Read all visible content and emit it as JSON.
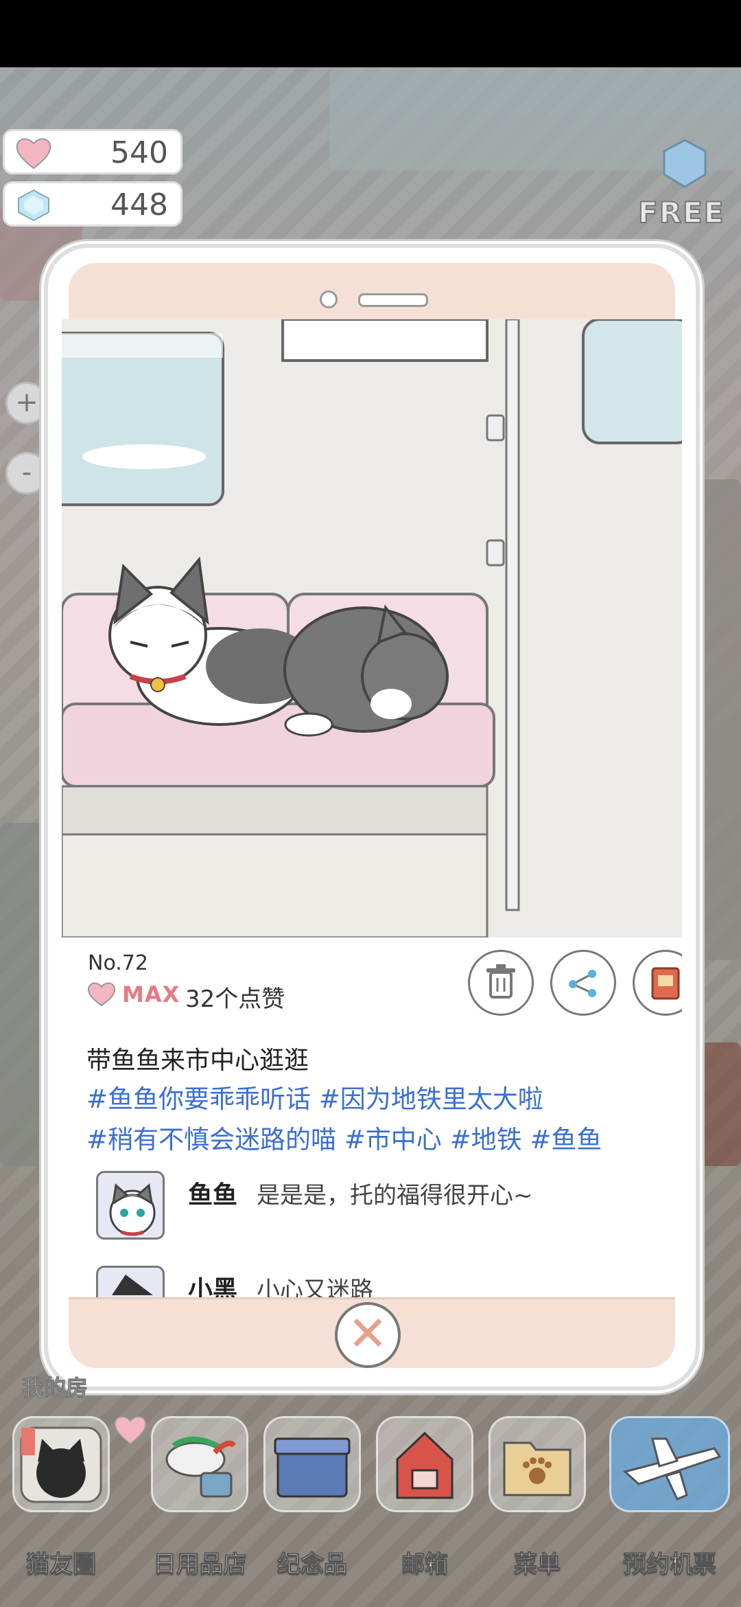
{
  "hud": {
    "hearts": "540",
    "gems": "448",
    "free_label": "FREE"
  },
  "side": {
    "zoom_in": "+",
    "zoom_out": "-"
  },
  "post": {
    "number": "No.72",
    "max_label": "MAX",
    "likes": "32个点赞",
    "caption": "带鱼鱼来市中心逛逛",
    "tags": [
      "#鱼鱼你要乖乖听话",
      "#因为地铁里太大啦",
      "#稍有不慎会迷路的喵",
      "#市中心",
      "#地铁",
      "#鱼鱼"
    ],
    "comments": [
      {
        "name": "鱼鱼",
        "text": "是是是，托的福得很开心~"
      },
      {
        "name": "小黑",
        "text": "小心又迷路"
      }
    ]
  },
  "room_label": "我的房",
  "dock": [
    {
      "label": "猫友圈",
      "icon": "black-cat-camera-icon"
    },
    {
      "label": "日用品店",
      "icon": "fish-shop-icon"
    },
    {
      "label": "纪念品",
      "icon": "souvenir-box-icon"
    },
    {
      "label": "邮箱",
      "icon": "mailbox-icon"
    },
    {
      "label": "菜单",
      "icon": "folder-paw-icon"
    },
    {
      "label": "预约机票",
      "icon": "airplane-icon"
    }
  ],
  "colors": {
    "accent_pink": "#e57a85",
    "tag_blue": "#3b6fd1",
    "phone_frame": "#f6e0d6"
  }
}
